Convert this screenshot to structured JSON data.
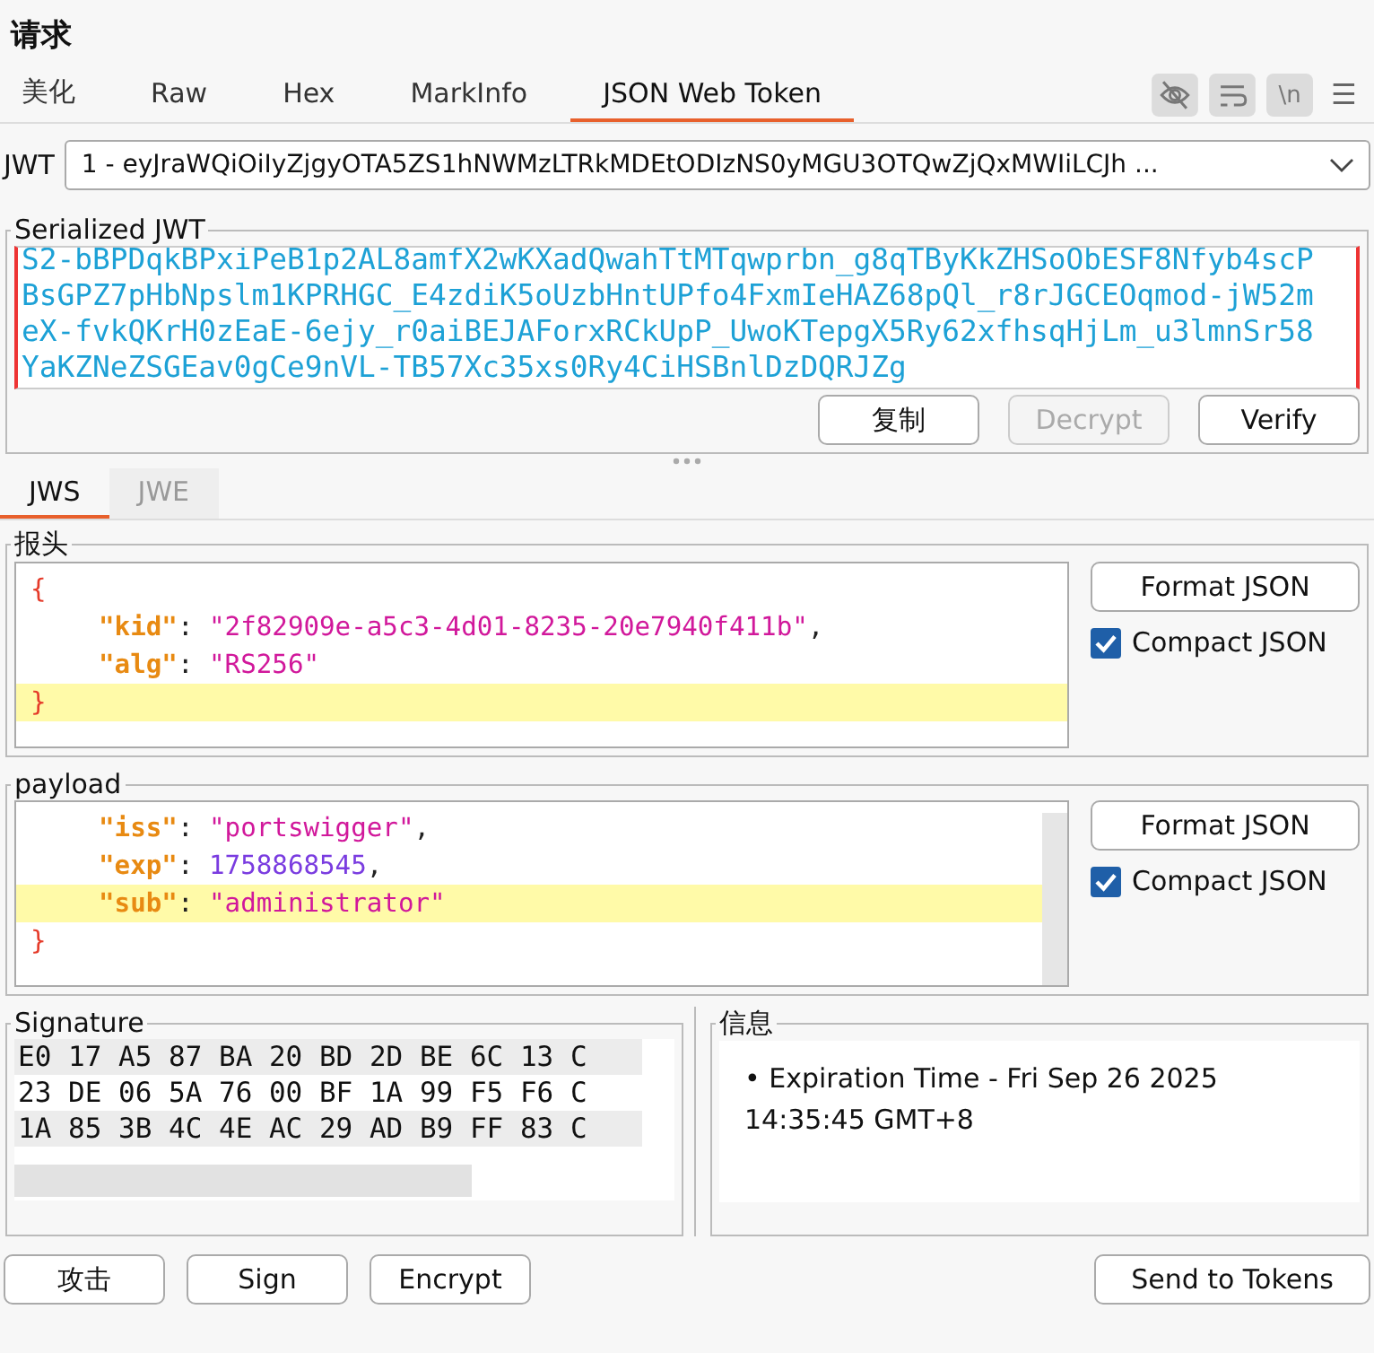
{
  "title": "请求",
  "tabs": [
    {
      "label": "美化",
      "selected": false
    },
    {
      "label": "Raw",
      "selected": false
    },
    {
      "label": "Hex",
      "selected": false
    },
    {
      "label": "MarkInfo",
      "selected": false
    },
    {
      "label": "JSON Web Token",
      "selected": true
    }
  ],
  "toolbar": {
    "newline_label": "\\n",
    "menu_label": "☰"
  },
  "jwt": {
    "label": "JWT",
    "value": "1 - eyJraWQiOiIyZjgyOTA5ZS1hNWMzLTRkMDEtODIzNS0yMGU3OTQwZjQxMWIiLCJh ..."
  },
  "serialized": {
    "legend": "Serialized JWT",
    "lines": [
      "S2-bBPDqkBPxiPeB1p2AL8amfX2wKXadQwahTtMTqwprbn_g8qTByKkZHSoObESF8Nfyb4scP",
      "BsGPZ7pHbNpslm1KPRHGC_E4zdiK5oUzbHntUPfo4FxmIeHAZ68pQl_r8rJGCEOqmod-jW52m",
      "eX-fvkQKrH0zEaE-6ejy_r0aiBEJAForxRCkUpP_UwoKTepgX5Ry62xfhsqHjLm_u3lmnSr58",
      "YaKZNeZSGEav0gCe9nVL-TB57Xc35xs0Ry4CiHSBnlDzDQRJZg"
    ],
    "buttons": [
      {
        "label": "复制",
        "disabled": false
      },
      {
        "label": "Decrypt",
        "disabled": true
      },
      {
        "label": "Verify",
        "disabled": false
      }
    ]
  },
  "subtabs": [
    {
      "label": "JWS",
      "selected": true
    },
    {
      "label": "JWE",
      "selected": false
    }
  ],
  "sections": [
    {
      "legend": "报头",
      "format_button": "Format JSON",
      "compact_label": "Compact JSON",
      "compact": true,
      "lines": [
        {
          "kind": "brace",
          "text": "{",
          "highlighted": false
        },
        {
          "kind": "string",
          "key": "\"kid\"",
          "sep": ": ",
          "value": "\"2f82909e-a5c3-4d01-8235-20e7940f411b\"",
          "comma": ",",
          "highlighted": false
        },
        {
          "kind": "string",
          "key": "\"alg\"",
          "sep": ": ",
          "value": "\"RS256\"",
          "highlighted": false
        },
        {
          "kind": "brace",
          "text": "}",
          "highlighted": true
        }
      ]
    },
    {
      "legend": "payload",
      "format_button": "Format JSON",
      "compact_label": "Compact JSON",
      "compact": true,
      "lines": [
        {
          "kind": "string",
          "key": "\"iss\"",
          "sep": ": ",
          "value": "\"portswigger\"",
          "comma": ",",
          "highlighted": false
        },
        {
          "kind": "number",
          "key": "\"exp\"",
          "sep": ": ",
          "value": "1758868545",
          "comma": ",",
          "highlighted": false
        },
        {
          "kind": "string",
          "key": "\"sub\"",
          "sep": ": ",
          "value": "\"administrator\"",
          "highlighted": true
        },
        {
          "kind": "brace",
          "text": "}",
          "highlighted": false
        }
      ]
    }
  ],
  "signature": {
    "legend": "Signature",
    "rows": [
      "E0 17 A5 87 BA 20 BD 2D BE 6C 13 C",
      "23 DE 06 5A 76 00 BF 1A 99 F5 F6 C",
      "1A 85 3B 4C 4E AC 29 AD B9 FF 83 C"
    ]
  },
  "info": {
    "legend": "信息",
    "items": [
      "• Expiration Time - Fri Sep 26 2025 14:35:45 GMT+8"
    ]
  },
  "actions": [
    "攻击",
    "Sign",
    "Encrypt"
  ],
  "send_button": "Send to Tokens"
}
